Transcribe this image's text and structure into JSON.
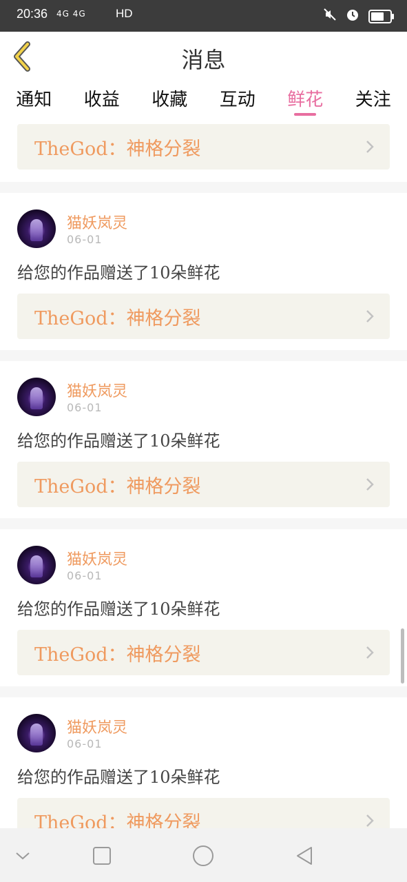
{
  "status_bar": {
    "time": "20:36",
    "network": "4G 4G",
    "hd": "HD"
  },
  "header": {
    "title": "消息"
  },
  "tabs": [
    {
      "label": "通知"
    },
    {
      "label": "收益"
    },
    {
      "label": "收藏"
    },
    {
      "label": "互动"
    },
    {
      "label": "鲜花",
      "active": true
    },
    {
      "label": "关注"
    }
  ],
  "feed": {
    "first_work_title": "TheGod：神格分裂",
    "items": [
      {
        "username": "猫妖岚灵",
        "date": "06-01",
        "message": "给您的作品赠送了10朵鲜花",
        "work_title": "TheGod：神格分裂"
      },
      {
        "username": "猫妖岚灵",
        "date": "06-01",
        "message": "给您的作品赠送了10朵鲜花",
        "work_title": "TheGod：神格分裂"
      },
      {
        "username": "猫妖岚灵",
        "date": "06-01",
        "message": "给您的作品赠送了10朵鲜花",
        "work_title": "TheGod：神格分裂"
      },
      {
        "username": "猫妖岚灵",
        "date": "06-01",
        "message": "给您的作品赠送了10朵鲜花",
        "work_title": "TheGod：神格分裂"
      }
    ]
  },
  "colors": {
    "accent": "#e86ea0",
    "username": "#ef9a5f",
    "back_arrow": "#f2d24a"
  },
  "icons": {
    "back": "back-arrow-icon",
    "chevron": "chevron-right-icon",
    "nav": [
      "nav-down-icon",
      "nav-square-icon",
      "nav-circle-icon",
      "nav-back-triangle-icon"
    ]
  }
}
